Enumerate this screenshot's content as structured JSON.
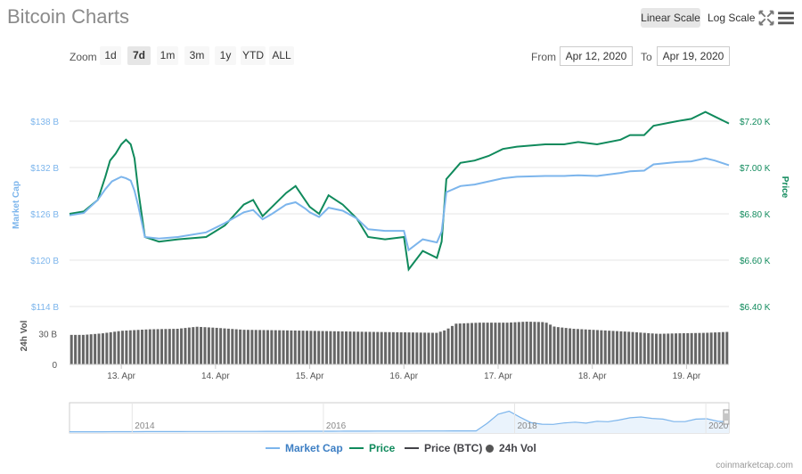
{
  "title": "Bitcoin Charts",
  "scale_buttons": {
    "linear": "Linear Scale",
    "log": "Log Scale"
  },
  "icons": {
    "fullscreen": "fullscreen-icon",
    "menu": "hamburger-menu-icon"
  },
  "zoom": {
    "label": "Zoom",
    "options": [
      "1d",
      "7d",
      "1m",
      "3m",
      "1y",
      "YTD",
      "ALL"
    ],
    "selected": "7d"
  },
  "range": {
    "from_label": "From",
    "from": "Apr 12, 2020",
    "to_label": "To",
    "to": "Apr 19, 2020"
  },
  "colors": {
    "market_cap": "#7cb5ec",
    "price": "#108a5c",
    "volume": "#555555",
    "btc": "#434348"
  },
  "legend": [
    "Market Cap",
    "Price",
    "Price (BTC)",
    "24h Vol"
  ],
  "credit": "coinmarketcap.com",
  "chart_data": {
    "type": "line",
    "x_unit": "day",
    "xlim": [
      12.45,
      19.45
    ],
    "x_ticks": [
      13,
      14,
      15,
      16,
      17,
      18,
      19
    ],
    "x_tick_labels": [
      "13. Apr",
      "14. Apr",
      "15. Apr",
      "16. Apr",
      "17. Apr",
      "18. Apr",
      "19. Apr"
    ],
    "left_axis": {
      "label": "Market Cap",
      "ticks": [
        114,
        120,
        126,
        132,
        138
      ],
      "tick_labels": [
        "$114 B",
        "$120 B",
        "$126 B",
        "$132 B",
        "$138 B"
      ],
      "ylim": [
        114,
        138
      ]
    },
    "right_axis": {
      "label": "Price",
      "ticks": [
        6.4,
        6.6,
        6.8,
        7.0,
        7.2
      ],
      "tick_labels": [
        "$6.40 K",
        "$6.60 K",
        "$6.80 K",
        "$7.00 K",
        "$7.20 K"
      ],
      "ylim": [
        6.4,
        7.2
      ]
    },
    "series": [
      {
        "name": "Price",
        "axis": "right",
        "x": [
          12.45,
          12.6,
          12.75,
          12.83,
          12.88,
          12.94,
          13.0,
          13.05,
          13.1,
          13.14,
          13.18,
          13.25,
          13.4,
          13.6,
          13.9,
          14.1,
          14.3,
          14.4,
          14.5,
          14.6,
          14.75,
          14.85,
          14.95,
          15.0,
          15.1,
          15.2,
          15.35,
          15.5,
          15.62,
          15.8,
          16.0,
          16.05,
          16.2,
          16.35,
          16.4,
          16.45,
          16.6,
          16.75,
          16.9,
          17.05,
          17.2,
          17.5,
          17.7,
          17.85,
          18.05,
          18.3,
          18.4,
          18.55,
          18.65,
          18.9,
          19.05,
          19.2,
          19.3,
          19.4,
          19.45
        ],
        "values": [
          6.8,
          6.81,
          6.86,
          6.96,
          7.03,
          7.06,
          7.1,
          7.12,
          7.1,
          7.04,
          6.9,
          6.7,
          6.68,
          6.69,
          6.7,
          6.75,
          6.84,
          6.86,
          6.79,
          6.83,
          6.89,
          6.92,
          6.86,
          6.83,
          6.8,
          6.88,
          6.84,
          6.78,
          6.7,
          6.69,
          6.7,
          6.56,
          6.64,
          6.61,
          6.68,
          6.95,
          7.02,
          7.03,
          7.05,
          7.08,
          7.09,
          7.1,
          7.1,
          7.11,
          7.1,
          7.12,
          7.14,
          7.14,
          7.18,
          7.2,
          7.21,
          7.24,
          7.22,
          7.2,
          7.19
        ]
      },
      {
        "name": "Market Cap",
        "axis": "left",
        "x": [
          12.45,
          12.6,
          12.75,
          12.83,
          12.9,
          13.0,
          13.05,
          13.1,
          13.14,
          13.18,
          13.25,
          13.4,
          13.6,
          13.9,
          14.1,
          14.3,
          14.4,
          14.5,
          14.6,
          14.75,
          14.85,
          14.95,
          15.0,
          15.1,
          15.2,
          15.35,
          15.5,
          15.62,
          15.8,
          16.0,
          16.05,
          16.2,
          16.35,
          16.4,
          16.45,
          16.6,
          16.75,
          16.9,
          17.05,
          17.2,
          17.5,
          17.7,
          17.85,
          18.05,
          18.3,
          18.4,
          18.55,
          18.65,
          18.9,
          19.05,
          19.2,
          19.3,
          19.4,
          19.45
        ],
        "values": [
          125.8,
          126.1,
          127.8,
          129.2,
          130.2,
          130.8,
          130.6,
          130.3,
          129.0,
          127.0,
          123.0,
          122.8,
          123.0,
          123.6,
          124.8,
          126.2,
          126.5,
          125.3,
          126.0,
          127.2,
          127.5,
          126.7,
          126.2,
          125.6,
          126.8,
          126.4,
          125.4,
          124.0,
          123.8,
          123.8,
          121.3,
          122.7,
          122.3,
          123.7,
          128.8,
          129.6,
          129.8,
          130.2,
          130.6,
          130.8,
          130.9,
          130.9,
          131.0,
          130.9,
          131.3,
          131.5,
          131.6,
          132.4,
          132.7,
          132.8,
          133.2,
          132.9,
          132.5,
          132.3
        ]
      }
    ],
    "volume": {
      "name": "24h Vol",
      "axis_label": "24h Vol",
      "ticks": [
        0,
        30
      ],
      "tick_labels": [
        "0",
        "30 B"
      ],
      "ylim": [
        0,
        56
      ],
      "x": [
        12.45,
        12.6,
        12.8,
        13.0,
        13.3,
        13.6,
        13.8,
        14.0,
        14.3,
        14.7,
        15.0,
        15.3,
        15.6,
        16.0,
        16.35,
        16.45,
        16.55,
        16.8,
        17.1,
        17.3,
        17.5,
        17.6,
        17.8,
        18.1,
        18.4,
        18.7,
        18.9,
        19.2,
        19.45
      ],
      "values": [
        29,
        29,
        30.5,
        33,
        34.5,
        35,
        37,
        36,
        34,
        33.5,
        33,
        32.5,
        32,
        31.5,
        31,
        34,
        40,
        41,
        41,
        42,
        41.5,
        37,
        35,
        33.5,
        32,
        30,
        30.5,
        31,
        32
      ]
    },
    "left_bound_ticks": {
      "114": "$114 B",
      "6.40": "$6.40 K"
    },
    "navigator": {
      "year_labels": [
        "2014",
        "2016",
        "2018",
        "2020"
      ]
    }
  }
}
